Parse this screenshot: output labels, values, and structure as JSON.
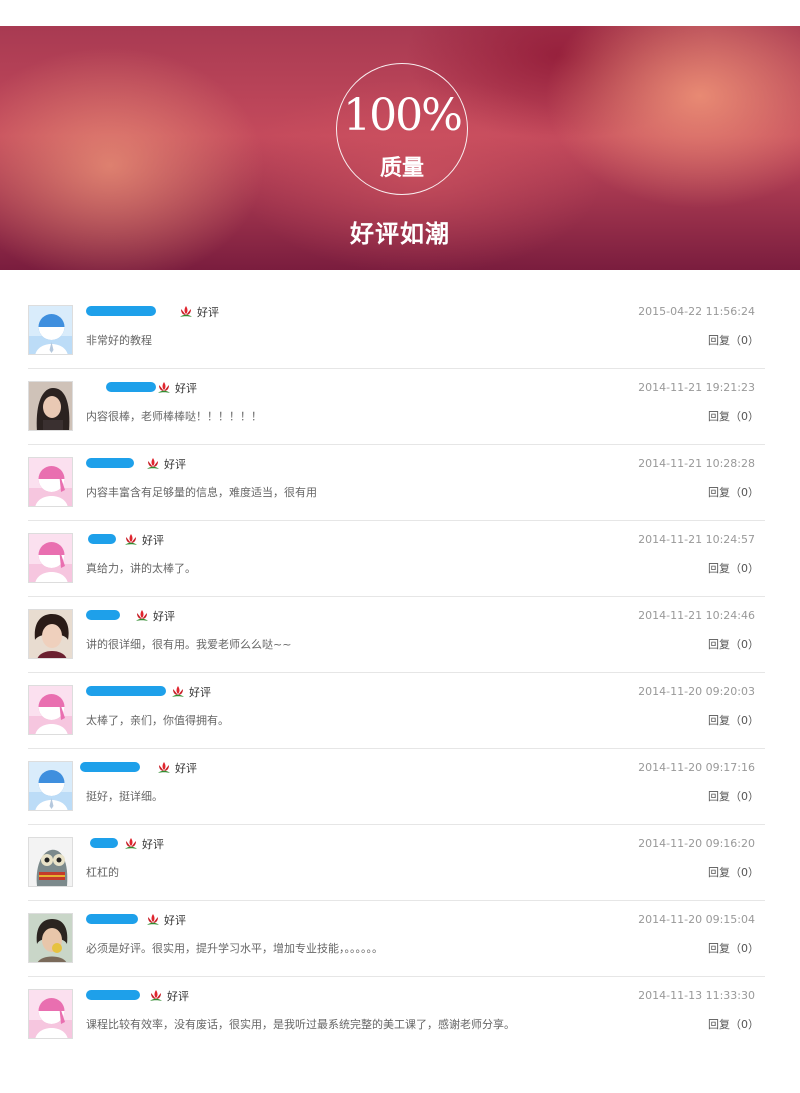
{
  "banner": {
    "percent": "100%",
    "quality": "质量",
    "slogan": "好评如潮"
  },
  "reviews": [
    {
      "avatar": "default-blue-avatar",
      "rating": "好评",
      "time": "2015-04-22 11:56:24",
      "comment": "非常好的教程",
      "reply": "回复（0）"
    },
    {
      "avatar": "photo-avatar-girl",
      "rating": "好评",
      "time": "2014-11-21 19:21:23",
      "comment": "内容很棒，老师棒棒哒！！！！！！",
      "reply": "回复（0）"
    },
    {
      "avatar": "default-pink-avatar",
      "rating": "好评",
      "time": "2014-11-21 10:28:28",
      "comment": "内容丰富含有足够量的信息，难度适当，很有用",
      "reply": "回复（0）"
    },
    {
      "avatar": "default-pink-avatar",
      "rating": "好评",
      "time": "2014-11-21 10:24:57",
      "comment": "真给力，讲的太棒了。",
      "reply": "回复（0）"
    },
    {
      "avatar": "photo-avatar-woman",
      "rating": "好评",
      "time": "2014-11-21 10:24:46",
      "comment": "讲的很详细，很有用。我爱老师么么哒~~",
      "reply": "回复（0）"
    },
    {
      "avatar": "default-pink-avatar",
      "rating": "好评",
      "time": "2014-11-20 09:20:03",
      "comment": "太棒了，亲们，你值得拥有。",
      "reply": "回复（0）"
    },
    {
      "avatar": "default-blue-avatar",
      "rating": "好评",
      "time": "2014-11-20 09:17:16",
      "comment": "挺好，挺详细。",
      "reply": "回复（0）"
    },
    {
      "avatar": "photo-avatar-cartoon",
      "rating": "好评",
      "time": "2014-11-20 09:16:20",
      "comment": "杠杠的",
      "reply": "回复（0）"
    },
    {
      "avatar": "photo-avatar-woman-2",
      "rating": "好评",
      "time": "2014-11-20 09:15:04",
      "comment": "必须是好评。很实用，提升学习水平，增加专业技能，。。。。。。",
      "reply": "回复（0）"
    },
    {
      "avatar": "default-pink-avatar",
      "rating": "好评",
      "time": "2014-11-13 11:33:30",
      "comment": "课程比较有效率，没有废话，很实用，是我听过最系统完整的美工课了，感谢老师分享。",
      "reply": "回复（0）"
    }
  ],
  "colors": {
    "blur": "#1ea0ea",
    "pink": "#e96fb0",
    "blue": "#3f8fde"
  }
}
